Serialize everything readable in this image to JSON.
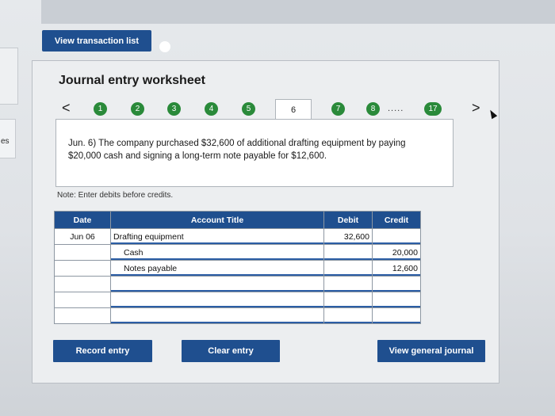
{
  "left_tab_label": "es",
  "view_transaction_list": "View transaction list",
  "worksheet_title": "Journal entry worksheet",
  "nav": {
    "prev": "<",
    "next": ">",
    "steps": [
      "1",
      "2",
      "3",
      "4",
      "5"
    ],
    "active_step": "6",
    "after_steps": [
      "7",
      "8"
    ],
    "ellipsis": ".....",
    "last_step": "17"
  },
  "description": "Jun. 6) The company purchased $32,600 of additional drafting equipment by paying $20,000 cash and signing a long-term note payable for $12,600.",
  "note": "Note: Enter debits before credits.",
  "table": {
    "headers": {
      "date": "Date",
      "account": "Account Title",
      "debit": "Debit",
      "credit": "Credit"
    },
    "rows": [
      {
        "date": "Jun 06",
        "account": "Drafting equipment",
        "debit": "32,600",
        "credit": ""
      },
      {
        "date": "",
        "account": "Cash",
        "debit": "",
        "credit": "20,000"
      },
      {
        "date": "",
        "account": "Notes payable",
        "debit": "",
        "credit": "12,600"
      },
      {
        "date": "",
        "account": "",
        "debit": "",
        "credit": ""
      },
      {
        "date": "",
        "account": "",
        "debit": "",
        "credit": ""
      },
      {
        "date": "",
        "account": "",
        "debit": "",
        "credit": ""
      }
    ]
  },
  "buttons": {
    "record": "Record entry",
    "clear": "Clear entry",
    "view_journal": "View general journal"
  }
}
